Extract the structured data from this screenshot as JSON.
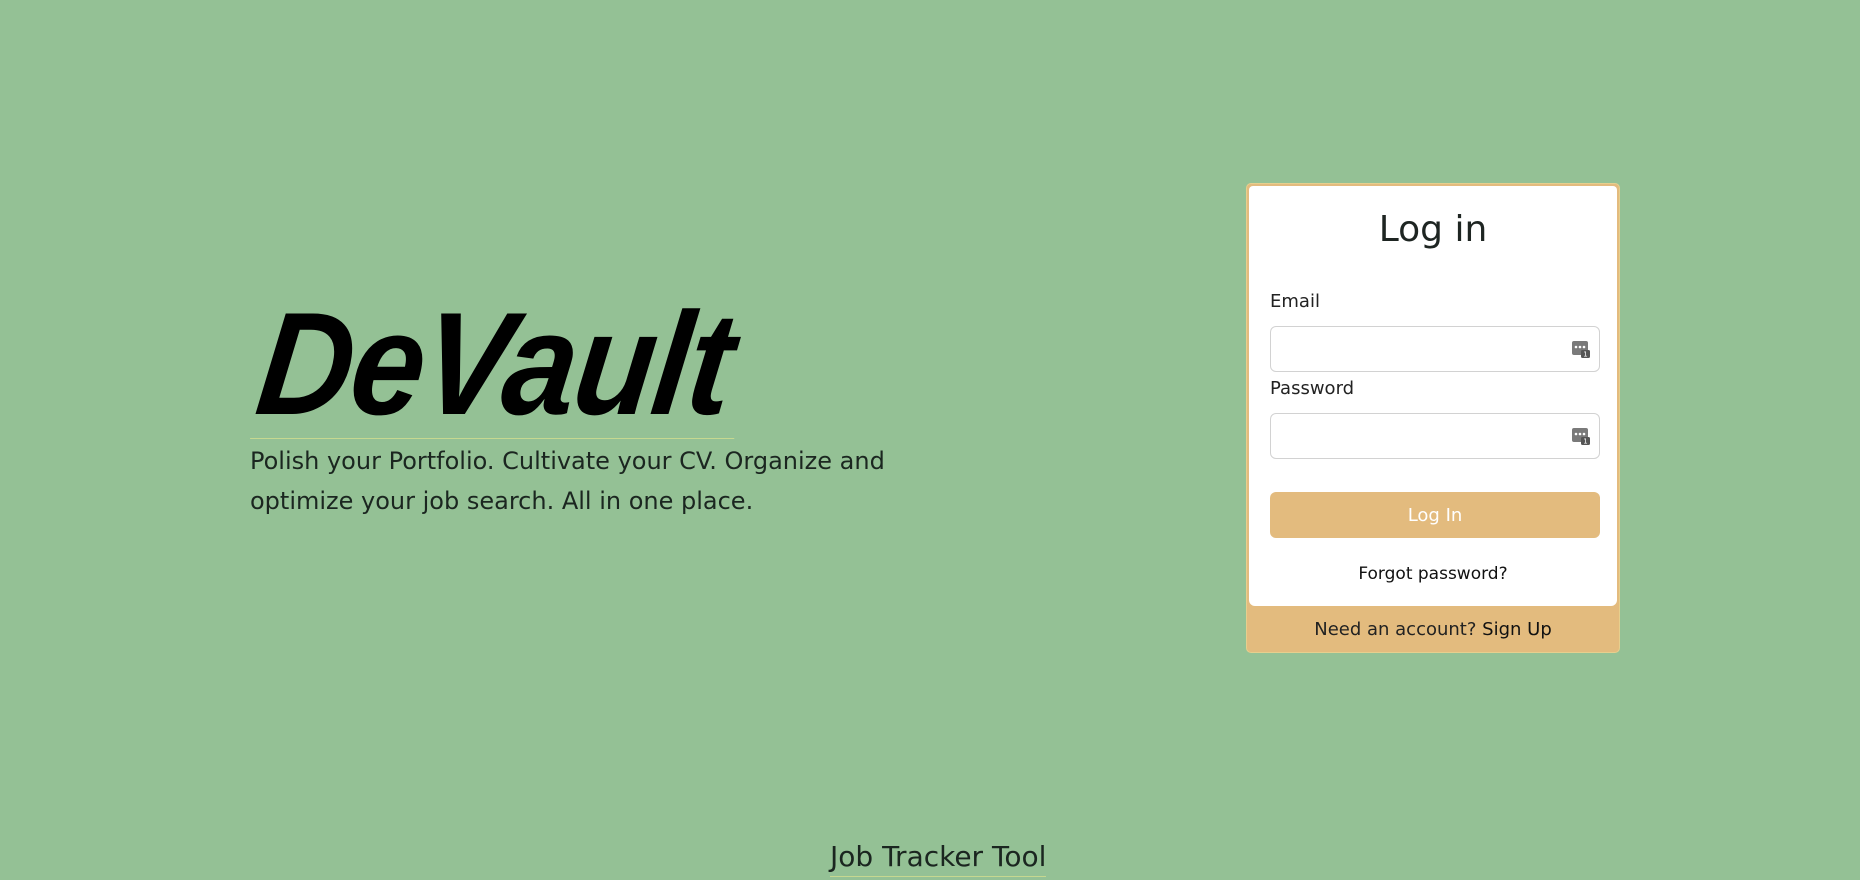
{
  "hero": {
    "brand": "DeVault",
    "tagline": "Polish your Portfolio. Cultivate your CV. Organize and optimize your job search. All in one place."
  },
  "login": {
    "title": "Log in",
    "email_label": "Email",
    "email_value": "",
    "password_label": "Password",
    "password_value": "",
    "submit_label": "Log In",
    "forgot_label": "Forgot password?",
    "footer_text": "Need an account?",
    "signup_label": "Sign Up",
    "field_icon": "password-manager-icon"
  },
  "footer_link": {
    "label": "Job Tracker Tool"
  },
  "colors": {
    "background": "#94c195",
    "accent": "#e3bb7e",
    "card_border": "#e6cf8e"
  }
}
